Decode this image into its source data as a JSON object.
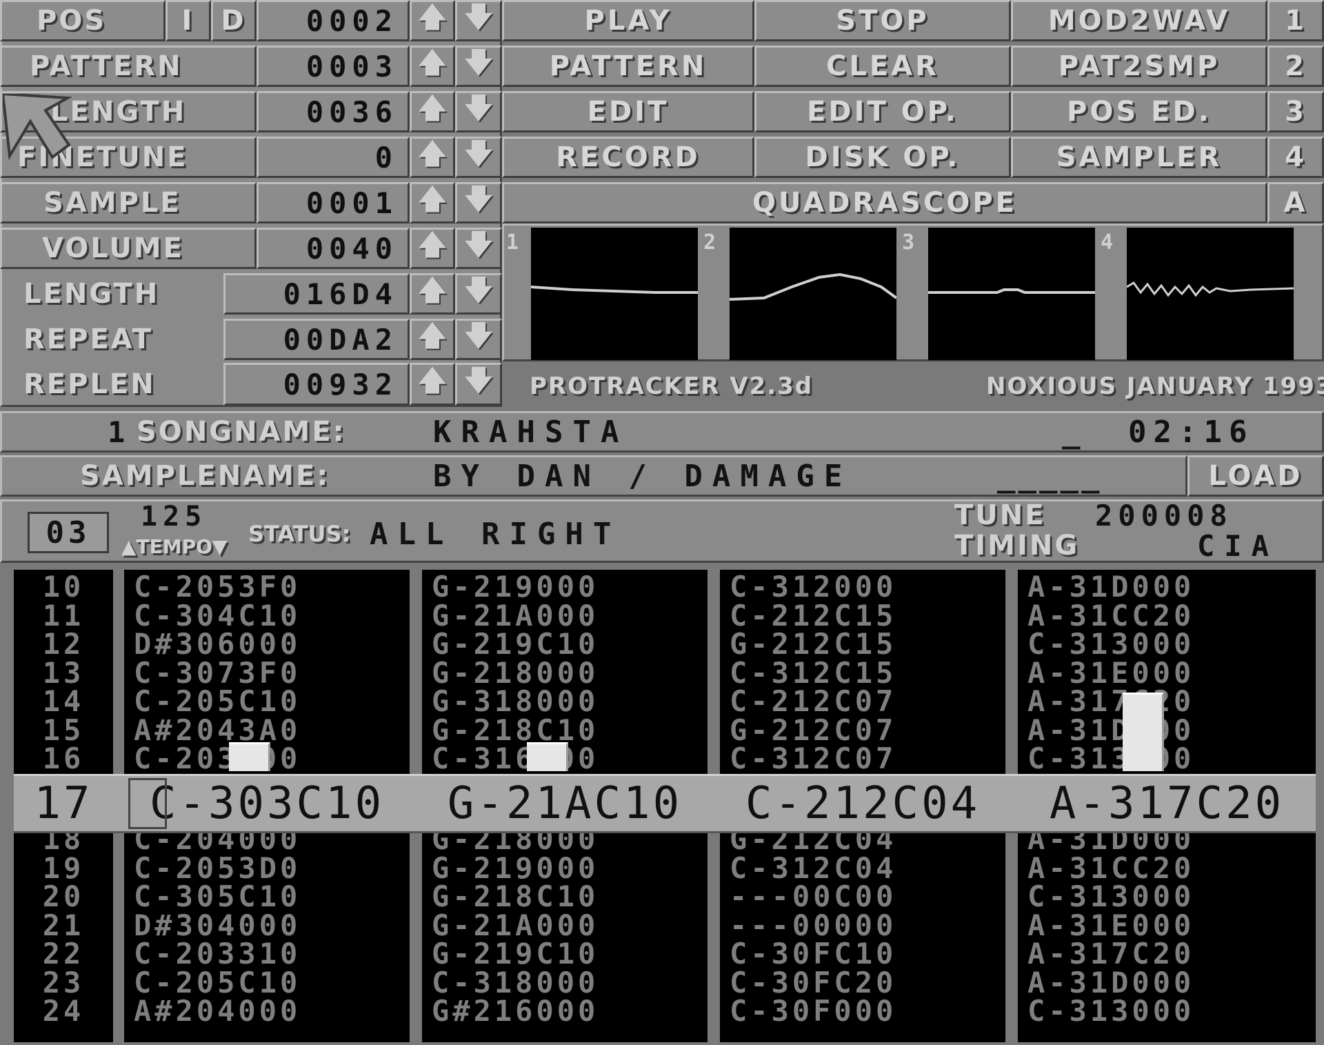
{
  "left_panel": {
    "pos": {
      "label": "POS",
      "insert": "I",
      "delete": "D",
      "value": "0002"
    },
    "pattern": {
      "label": "PATTERN",
      "value": "0003"
    },
    "length": {
      "label": "LENGTH",
      "value": "0036"
    },
    "finetune": {
      "label": "FINETUNE",
      "value": "0"
    },
    "sample": {
      "label": "SAMPLE",
      "value": "0001"
    },
    "volume": {
      "label": "VOLUME",
      "value": "0040"
    },
    "sample_length": {
      "label": "LENGTH",
      "value": "016D4"
    },
    "repeat": {
      "label": "REPEAT",
      "value": "00DA2"
    },
    "replen": {
      "label": "REPLEN",
      "value": "00932"
    },
    "arrow_up": "🡅",
    "arrow_down": "🡇"
  },
  "buttons": {
    "row1": [
      "PLAY",
      "STOP",
      "MOD2WAV",
      "1"
    ],
    "row2": [
      "PATTERN",
      "CLEAR",
      "PAT2SMP",
      "2"
    ],
    "row3": [
      "EDIT",
      "EDIT OP.",
      "POS ED.",
      "3"
    ],
    "row4": [
      "RECORD",
      "DISK OP.",
      "SAMPLER",
      "4"
    ],
    "quadrascope": "QUADRASCOPE",
    "quadrascope_key": "A"
  },
  "scope_labels": [
    "1",
    "2",
    "3",
    "4"
  ],
  "footer": {
    "left": "PROTRACKER V2.3d",
    "right": "NOXIOUS JANUARY 1993"
  },
  "song": {
    "number": "1",
    "label": "SONGNAME:",
    "name": "KRAHSTA",
    "cursor": "_",
    "time": "02:16"
  },
  "sample_name": {
    "label": "SAMPLENAME:",
    "name": "BY DAN / DAMAGE",
    "blank": "_____",
    "load": "LOAD"
  },
  "status_bar": {
    "pattern_num": "03",
    "tempo_value": "125",
    "tempo_label": "▲TEMPO▼",
    "status_label": "STATUS:",
    "status_text": "ALL RIGHT",
    "tune_label": "TUNE",
    "tune_value": "200008",
    "timing_label": "TIMING",
    "timing_value": "CIA"
  },
  "pattern": {
    "rows_before": [
      "10",
      "11",
      "12",
      "13",
      "14",
      "15",
      "16"
    ],
    "current_row": "17",
    "rows_after": [
      "18",
      "19",
      "20",
      "21",
      "22",
      "23",
      "24"
    ],
    "tracks": [
      {
        "before": [
          "C-2053F0",
          "C-304C10",
          "D#306000",
          "C-3073F0",
          "C-205C10",
          "A#2043A0",
          "C-203000"
        ],
        "current": "C-303C10",
        "after": [
          "C-204000",
          "C-2053D0",
          "C-305C10",
          "D#304000",
          "C-203310",
          "C-205C10",
          "A#204000"
        ]
      },
      {
        "before": [
          "G-219000",
          "G-21A000",
          "G-219C10",
          "G-218000",
          "G-318000",
          "G-218C10",
          "C-316000"
        ],
        "current": "G-21AC10",
        "after": [
          "G-218000",
          "G-219000",
          "G-218C10",
          "G-21A000",
          "G-219C10",
          "C-318000",
          "G#216000"
        ]
      },
      {
        "before": [
          "C-312000",
          "C-212C15",
          "G-212C15",
          "C-312C15",
          "C-212C07",
          "G-212C07",
          "C-312C07"
        ],
        "current": "C-212C04",
        "after": [
          "G-212C04",
          "C-312C04",
          "---00C00",
          "---00000",
          "C-30FC10",
          "C-30FC20",
          "C-30F000"
        ]
      },
      {
        "before": [
          "A-31D000",
          "A-31CC20",
          "C-313000",
          "A-31E000",
          "A-317C20",
          "A-31D000",
          "C-313000"
        ],
        "current": "A-317C20",
        "after": [
          "A-31D000",
          "A-31CC20",
          "C-313000",
          "A-31E000",
          "A-317C20",
          "A-31D000",
          "C-313000"
        ]
      }
    ]
  }
}
